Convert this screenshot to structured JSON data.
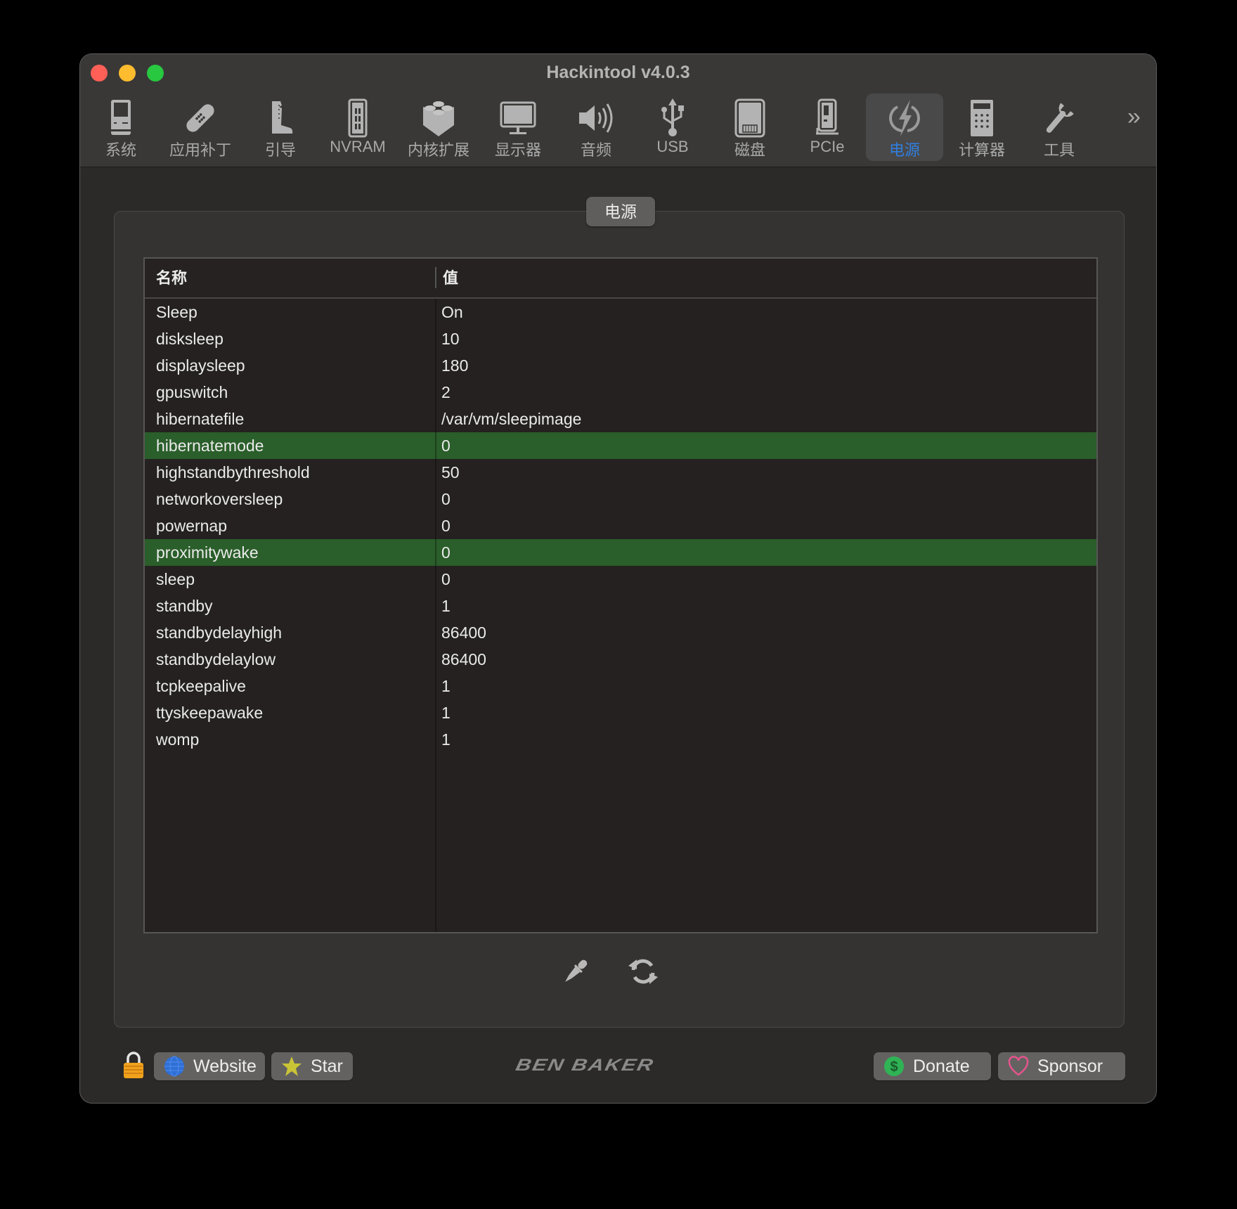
{
  "window": {
    "title": "Hackintool v4.0.3"
  },
  "toolbar": {
    "items": [
      {
        "label": "系统",
        "icon": "computer-icon"
      },
      {
        "label": "应用补丁",
        "icon": "bandage-icon"
      },
      {
        "label": "引导",
        "icon": "boot-icon"
      },
      {
        "label": "NVRAM",
        "icon": "memory-chip-icon"
      },
      {
        "label": "内核扩展",
        "icon": "lego-brick-icon"
      },
      {
        "label": "显示器",
        "icon": "monitor-icon"
      },
      {
        "label": "音频",
        "icon": "speaker-icon"
      },
      {
        "label": "USB",
        "icon": "usb-icon"
      },
      {
        "label": "磁盘",
        "icon": "disk-icon"
      },
      {
        "label": "PCIe",
        "icon": "pcie-card-icon"
      },
      {
        "label": "电源",
        "icon": "power-bolt-icon",
        "active": true
      },
      {
        "label": "计算器",
        "icon": "calculator-icon"
      },
      {
        "label": "工具",
        "icon": "wrench-icon"
      }
    ],
    "more": "»"
  },
  "panel": {
    "title": "电源",
    "columns": [
      "名称",
      "值"
    ],
    "rows": [
      {
        "name": "Sleep",
        "value": "On"
      },
      {
        "name": "disksleep",
        "value": "10"
      },
      {
        "name": "displaysleep",
        "value": "180"
      },
      {
        "name": "gpuswitch",
        "value": "2"
      },
      {
        "name": "hibernatefile",
        "value": "/var/vm/sleepimage"
      },
      {
        "name": "hibernatemode",
        "value": "0",
        "highlighted": true
      },
      {
        "name": "highstandbythreshold",
        "value": "50"
      },
      {
        "name": "networkoversleep",
        "value": "0"
      },
      {
        "name": "powernap",
        "value": "0"
      },
      {
        "name": "proximitywake",
        "value": "0",
        "highlighted": true
      },
      {
        "name": "sleep",
        "value": "0"
      },
      {
        "name": "standby",
        "value": "1"
      },
      {
        "name": "standbydelayhigh",
        "value": "86400"
      },
      {
        "name": "standbydelaylow",
        "value": "86400"
      },
      {
        "name": "tcpkeepalive",
        "value": "1"
      },
      {
        "name": "ttyskeepawake",
        "value": "1"
      },
      {
        "name": "womp",
        "value": "1"
      }
    ],
    "actions": [
      {
        "name": "fix-button",
        "icon": "dropper-icon"
      },
      {
        "name": "refresh-button",
        "icon": "refresh-icon"
      }
    ],
    "highlight_color": "#2a5e2a"
  },
  "footer": {
    "website_label": "Website",
    "star_label": "Star",
    "logo_text": "BEN BAKER",
    "donate_label": "Donate",
    "sponsor_label": "Sponsor"
  },
  "colors": {
    "accent": "#2f7fe0",
    "close": "#fe5f57",
    "minimize": "#febc2e",
    "maximize": "#28c840"
  }
}
